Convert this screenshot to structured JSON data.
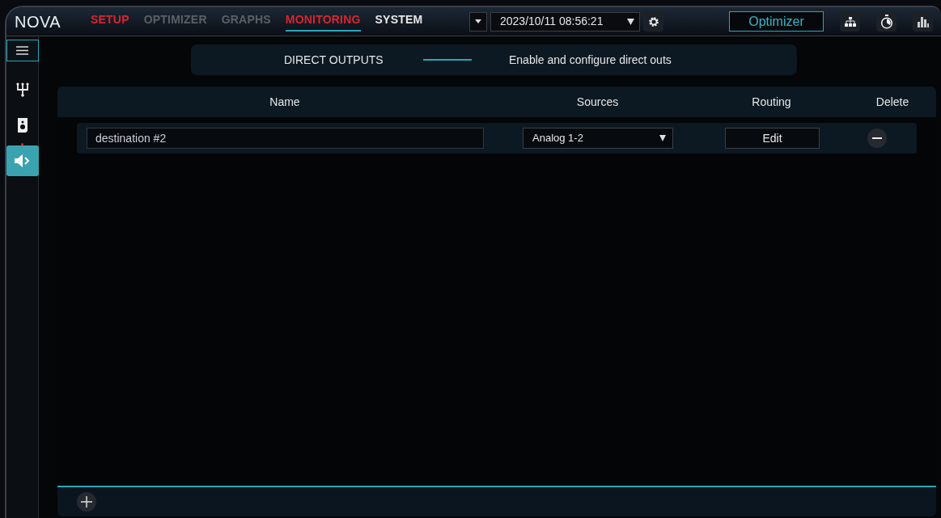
{
  "app": {
    "logo": "NOVA"
  },
  "tabs": [
    {
      "label": "SETUP",
      "selected": false,
      "alert": true,
      "disabled": false
    },
    {
      "label": "OPTIMIZER",
      "selected": false,
      "alert": false,
      "disabled": true
    },
    {
      "label": "GRAPHS",
      "selected": false,
      "alert": false,
      "disabled": true
    },
    {
      "label": "MONITORING",
      "selected": true,
      "alert": true,
      "disabled": false
    },
    {
      "label": "SYSTEM",
      "selected": false,
      "alert": false,
      "disabled": false
    }
  ],
  "toolbar": {
    "datetime": "2023/10/11 08:56:21",
    "mode_button": "Optimizer"
  },
  "sidebar": {
    "items": [
      {
        "kind": "split",
        "selected": false
      },
      {
        "kind": "speaker",
        "selected": false
      },
      {
        "kind": "output",
        "selected": true
      }
    ]
  },
  "panel": {
    "title": "DIRECT OUTPUTS",
    "subtitle": "Enable and configure direct outs"
  },
  "table": {
    "columns": [
      "Name",
      "Sources",
      "Routing",
      "Delete"
    ],
    "rows": [
      {
        "name": "destination #2",
        "source": "Analog 1-2",
        "routing": "Edit"
      }
    ]
  }
}
